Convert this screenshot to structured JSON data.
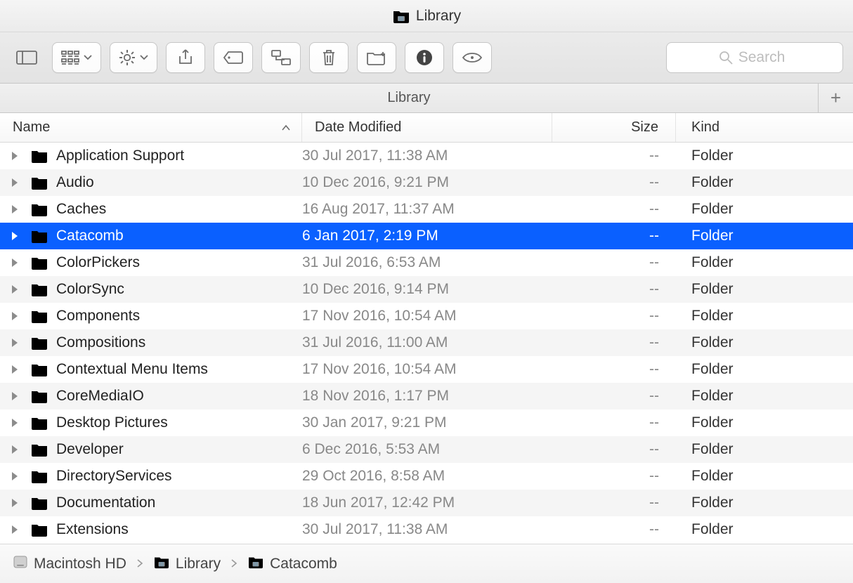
{
  "window": {
    "title": "Library"
  },
  "toolbar": {
    "search_placeholder": "Search"
  },
  "tabs": {
    "current": "Library",
    "newtab_glyph": "+"
  },
  "columns": {
    "name": "Name",
    "date": "Date Modified",
    "size": "Size",
    "kind": "Kind",
    "sort_caret": "˄"
  },
  "rows": [
    {
      "name": "Application Support",
      "date": "30 Jul 2017, 11:38 AM",
      "size": "--",
      "kind": "Folder",
      "selected": false
    },
    {
      "name": "Audio",
      "date": "10 Dec 2016, 9:21 PM",
      "size": "--",
      "kind": "Folder",
      "selected": false
    },
    {
      "name": "Caches",
      "date": "16 Aug 2017, 11:37 AM",
      "size": "--",
      "kind": "Folder",
      "selected": false
    },
    {
      "name": "Catacomb",
      "date": "6 Jan 2017, 2:19 PM",
      "size": "--",
      "kind": "Folder",
      "selected": true
    },
    {
      "name": "ColorPickers",
      "date": "31 Jul 2016, 6:53 AM",
      "size": "--",
      "kind": "Folder",
      "selected": false
    },
    {
      "name": "ColorSync",
      "date": "10 Dec 2016, 9:14 PM",
      "size": "--",
      "kind": "Folder",
      "selected": false
    },
    {
      "name": "Components",
      "date": "17 Nov 2016, 10:54 AM",
      "size": "--",
      "kind": "Folder",
      "selected": false
    },
    {
      "name": "Compositions",
      "date": "31 Jul 2016, 11:00 AM",
      "size": "--",
      "kind": "Folder",
      "selected": false
    },
    {
      "name": "Contextual Menu Items",
      "date": "17 Nov 2016, 10:54 AM",
      "size": "--",
      "kind": "Folder",
      "selected": false
    },
    {
      "name": "CoreMediaIO",
      "date": "18 Nov 2016, 1:17 PM",
      "size": "--",
      "kind": "Folder",
      "selected": false
    },
    {
      "name": "Desktop Pictures",
      "date": "30 Jan 2017, 9:21 PM",
      "size": "--",
      "kind": "Folder",
      "selected": false
    },
    {
      "name": "Developer",
      "date": "6 Dec 2016, 5:53 AM",
      "size": "--",
      "kind": "Folder",
      "selected": false
    },
    {
      "name": "DirectoryServices",
      "date": "29 Oct 2016, 8:58 AM",
      "size": "--",
      "kind": "Folder",
      "selected": false
    },
    {
      "name": "Documentation",
      "date": "18 Jun 2017, 12:42 PM",
      "size": "--",
      "kind": "Folder",
      "selected": false
    },
    {
      "name": "Extensions",
      "date": "30 Jul 2017, 11:38 AM",
      "size": "--",
      "kind": "Folder",
      "selected": false
    }
  ],
  "path": [
    {
      "icon": "hd",
      "label": "Macintosh HD"
    },
    {
      "icon": "folder",
      "label": "Library"
    },
    {
      "icon": "folder",
      "label": "Catacomb"
    }
  ]
}
